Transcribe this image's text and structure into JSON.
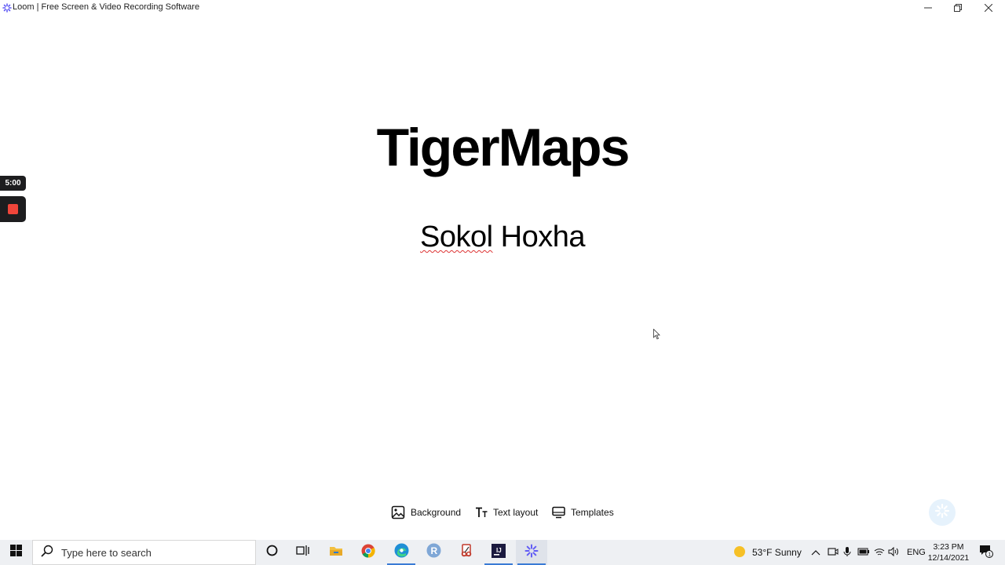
{
  "window": {
    "title": "Loom | Free Screen & Video Recording Software",
    "icon": "loom-icon"
  },
  "slide": {
    "title": "TigerMaps",
    "subtitle_first": "Sokol",
    "subtitle_rest": " Hoxha"
  },
  "recorder": {
    "timer": "5:00",
    "stop_color": "#f0453a"
  },
  "toolbar": {
    "background_label": "Background",
    "text_layout_label": "Text layout",
    "templates_label": "Templates"
  },
  "taskbar": {
    "search_placeholder": "Type here to search",
    "weather_text": "53°F  Sunny",
    "language": "ENG",
    "time": "3:23 PM",
    "date": "12/14/2021",
    "notification_count": "1"
  },
  "colors": {
    "accent": "#3a7bd5",
    "recorder_bg": "#1d1d1f",
    "loom_purple": "#625df5"
  }
}
